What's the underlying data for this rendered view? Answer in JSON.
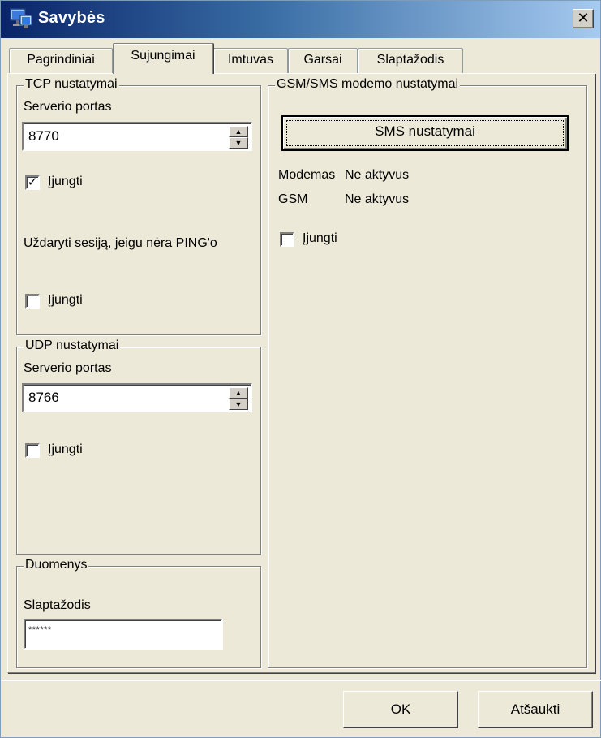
{
  "window": {
    "title": "Savybės"
  },
  "tabs": [
    "Pagrindiniai",
    "Sujungimai",
    "Imtuvas",
    "Garsai",
    "Slaptažodis"
  ],
  "tcp": {
    "group_title": "TCP nustatymai",
    "port_label": "Serverio portas",
    "port_value": "8770",
    "enable_label": "Įjungti",
    "enable_checked": true,
    "close_session_label": "Uždaryti sesiją, jeigu nėra PING'o",
    "close_enable_label": "Įjungti",
    "close_enable_checked": false
  },
  "udp": {
    "group_title": "UDP nustatymai",
    "port_label": "Serverio portas",
    "port_value": "8766",
    "enable_label": "Įjungti",
    "enable_checked": false
  },
  "data_group": {
    "group_title": "Duomenys",
    "password_label": "Slaptažodis",
    "password_value": "******"
  },
  "gsm": {
    "group_title": "GSM/SMS modemo nustatymai",
    "sms_button": "SMS nustatymai",
    "modem_label": "Modemas",
    "modem_status": "Ne aktyvus",
    "gsm_label": "GSM",
    "gsm_status": "Ne aktyvus",
    "enable_label": "Įjungti",
    "enable_checked": false
  },
  "buttons": {
    "ok": "OK",
    "cancel": "Atšaukti"
  },
  "icons": {
    "app": "computer-network-icon",
    "close": "close-icon",
    "spin_up": "arrow-up-icon",
    "spin_down": "arrow-down-icon",
    "checkmark": "checkmark-icon"
  },
  "colors": {
    "title_start": "#0a246a",
    "title_end": "#a6caf0",
    "face": "#ece9d8"
  }
}
